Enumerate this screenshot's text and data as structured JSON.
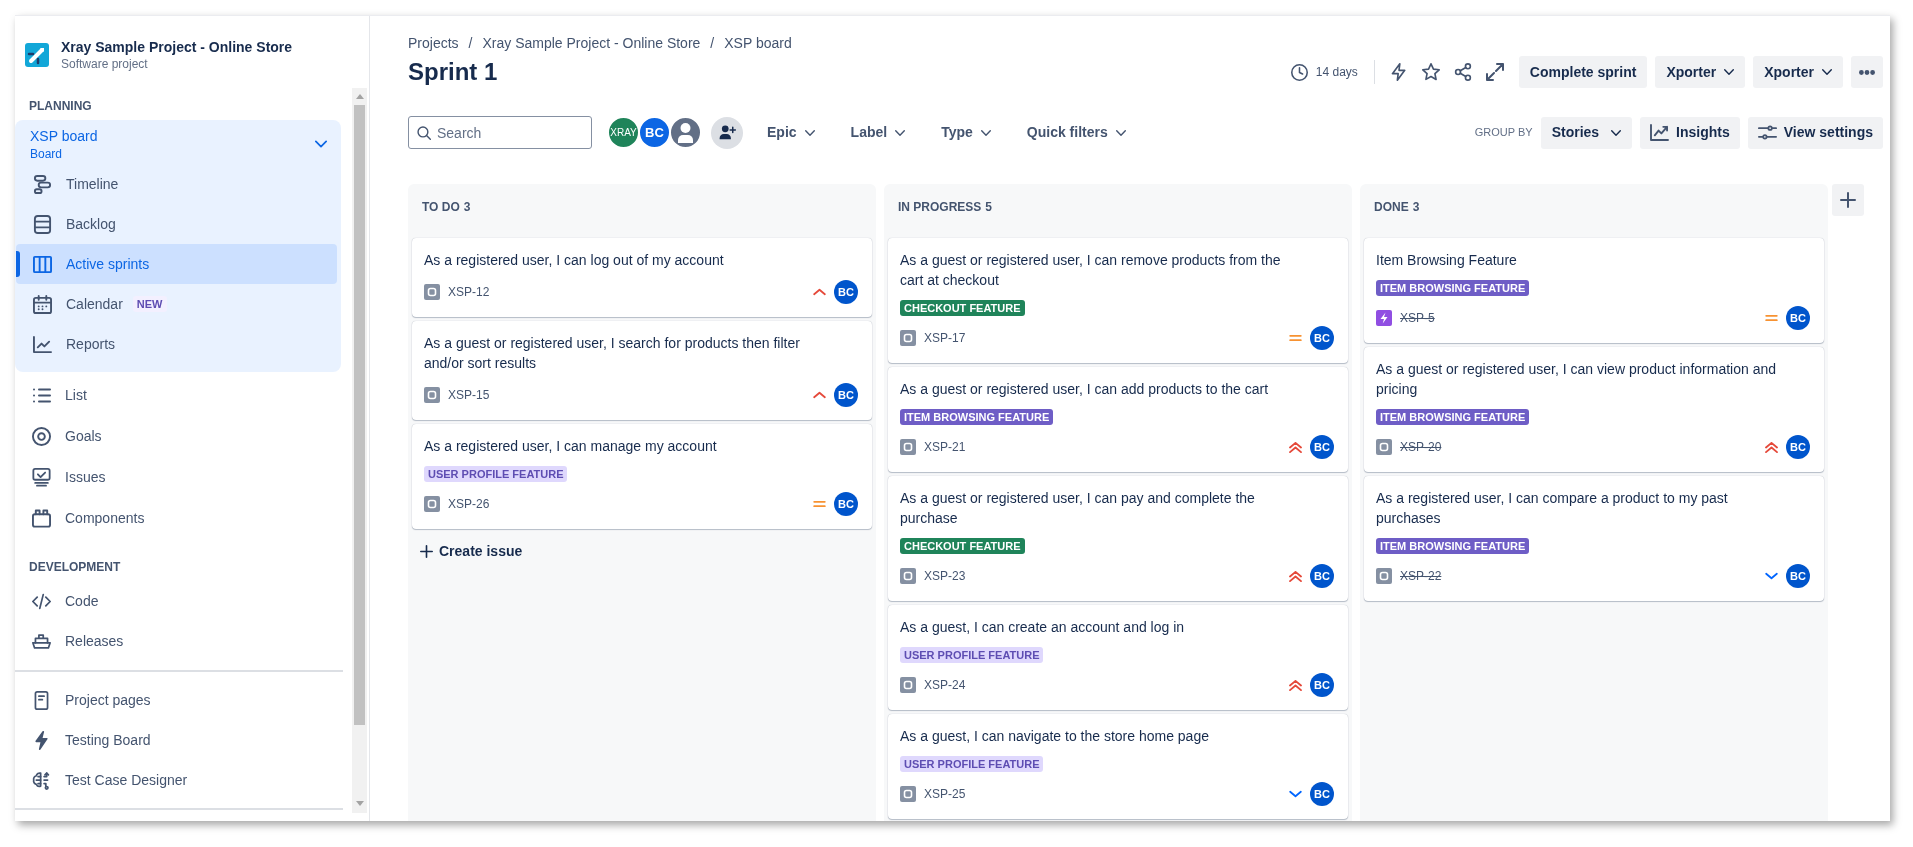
{
  "sidebar": {
    "project": {
      "name": "Xray Sample Project - Online Store",
      "type": "Software project"
    },
    "sections": [
      {
        "heading": "PLANNING",
        "board": {
          "title": "XSP board",
          "subtitle": "Board",
          "expanded": true,
          "items": [
            {
              "label": "Timeline",
              "selected": false
            },
            {
              "label": "Backlog",
              "selected": false
            },
            {
              "label": "Active sprints",
              "selected": true
            },
            {
              "label": "Calendar",
              "badge": "NEW",
              "selected": false
            },
            {
              "label": "Reports",
              "selected": false
            }
          ]
        },
        "items": [
          {
            "label": "List",
            "selected": false
          },
          {
            "label": "Goals",
            "selected": false
          },
          {
            "label": "Issues",
            "selected": false
          },
          {
            "label": "Components",
            "selected": false
          }
        ]
      },
      {
        "heading": "DEVELOPMENT",
        "items": [
          {
            "label": "Code",
            "selected": false
          },
          {
            "label": "Releases",
            "selected": false
          }
        ]
      }
    ],
    "shortcuts": [
      {
        "label": "Project pages",
        "selected": false
      },
      {
        "label": "Testing Board",
        "selected": false
      },
      {
        "label": "Test Case Designer",
        "selected": false
      }
    ]
  },
  "header": {
    "breadcrumbs": [
      {
        "label": "Projects",
        "separator": "/"
      },
      {
        "label": "Xray Sample Project - Online Store",
        "separator": "/"
      },
      {
        "label": "XSP board"
      }
    ],
    "title": "Sprint 1",
    "duration": "14 days",
    "actions": [
      {
        "label": "Complete sprint",
        "dropdown": false
      },
      {
        "label": "Xporter",
        "dropdown": true
      },
      {
        "label": "Xporter",
        "dropdown": true
      }
    ]
  },
  "toolbar": {
    "search": {
      "placeholder": "Search"
    },
    "avatars": [
      {
        "kind": "initials",
        "text": "XRAY",
        "color": "#1f845a"
      },
      {
        "kind": "initials",
        "text": "BC",
        "color": "#0c66e4"
      },
      {
        "kind": "silhouette",
        "color": "#626f86"
      }
    ],
    "filters": [
      "Epic",
      "Label",
      "Type",
      "Quick filters"
    ],
    "group_by": {
      "label": "GROUP BY",
      "value": "Stories"
    },
    "buttons": [
      "Insights",
      "View settings"
    ]
  },
  "board": {
    "columns": [
      {
        "title": "TO DO",
        "count": "3",
        "create_issue": "Create issue",
        "cards": [
          {
            "kind": "issue",
            "summary": "As a registered user, I can log out of my account",
            "key": "XSP-12",
            "resolved": false,
            "priority": {
              "kind": "high"
            },
            "assignee": "BC"
          },
          {
            "kind": "issue",
            "summary": "As a guest or registered user, I search for products then filter and/or sort results",
            "key": "XSP-15",
            "resolved": false,
            "priority": {
              "kind": "high"
            },
            "assignee": "BC"
          },
          {
            "kind": "issue",
            "summary": "As a registered user, I can manage my account",
            "tag": {
              "text": "USER PROFILE FEATURE",
              "color": "#dfd8fd"
            },
            "key": "XSP-26",
            "resolved": false,
            "priority": {
              "kind": "medium"
            },
            "assignee": "BC"
          }
        ]
      },
      {
        "title": "IN PROGRESS",
        "count": "5",
        "cards": [
          {
            "kind": "issue",
            "summary": "As a guest or registered user, I can remove products from the cart at checkout",
            "tag": {
              "text": "CHECKOUT FEATURE",
              "color": "#1f845a"
            },
            "key": "XSP-17",
            "resolved": false,
            "priority": {
              "kind": "medium"
            },
            "assignee": "BC"
          },
          {
            "kind": "issue",
            "summary": "As a guest or registered user, I can add products to the cart",
            "tag": {
              "text": "ITEM BROWSING FEATURE",
              "color": "#6e5dc6"
            },
            "key": "XSP-21",
            "resolved": false,
            "priority": {
              "kind": "highest"
            },
            "assignee": "BC"
          },
          {
            "kind": "issue",
            "summary": "As a guest or registered user, I can pay and complete the purchase",
            "tag": {
              "text": "CHECKOUT FEATURE",
              "color": "#1f845a"
            },
            "key": "XSP-23",
            "resolved": false,
            "priority": {
              "kind": "highest"
            },
            "assignee": "BC"
          },
          {
            "kind": "issue",
            "summary": "As a guest, I can create an account and log in",
            "tag": {
              "text": "USER PROFILE FEATURE",
              "color": "#dfd8fd"
            },
            "key": "XSP-24",
            "resolved": false,
            "priority": {
              "kind": "highest"
            },
            "assignee": "BC"
          },
          {
            "kind": "issue",
            "summary": "As a guest, I can navigate to the store home page",
            "tag": {
              "text": "USER PROFILE FEATURE",
              "color": "#dfd8fd"
            },
            "key": "XSP-25",
            "resolved": false,
            "priority": {
              "kind": "low"
            },
            "assignee": "BC"
          }
        ]
      },
      {
        "title": "DONE",
        "count": "3",
        "cards": [
          {
            "kind": "epic",
            "summary": "Item Browsing Feature",
            "tag": {
              "text": "ITEM BROWSING FEATURE",
              "color": "#6e5dc6"
            },
            "key": "XSP-5",
            "resolved": true,
            "priority": {
              "kind": "medium"
            },
            "assignee": "BC"
          },
          {
            "kind": "issue",
            "summary": "As a guest or registered user, I can view product information and pricing",
            "tag": {
              "text": "ITEM BROWSING FEATURE",
              "color": "#6e5dc6"
            },
            "key": "XSP-20",
            "resolved": true,
            "priority": {
              "kind": "highest"
            },
            "assignee": "BC"
          },
          {
            "kind": "issue",
            "summary": "As a registered user, I can compare a product to my past purchases",
            "tag": {
              "text": "ITEM BROWSING FEATURE",
              "color": "#6e5dc6"
            },
            "key": "XSP-22",
            "resolved": true,
            "priority": {
              "kind": "low"
            },
            "assignee": "BC"
          }
        ]
      }
    ]
  }
}
